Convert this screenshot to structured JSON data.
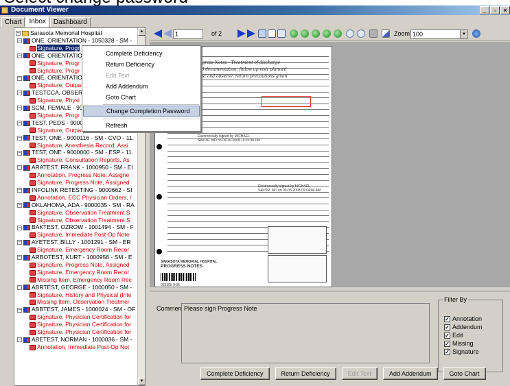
{
  "caption": "Select change password",
  "window": {
    "title": "Document Viewer",
    "minimize": "_",
    "restore": "▫",
    "close": "×"
  },
  "tabs": [
    "Chart",
    "Inbox",
    "Dashboard"
  ],
  "tree": {
    "rows": [
      {
        "type": "root",
        "label": "Sarasota Memorial Hospital"
      },
      {
        "type": "patient",
        "label": "ONE, ORIENTATION - 1050328 - SM -"
      },
      {
        "type": "item",
        "label": "Signature, Progr",
        "selected": true
      },
      {
        "type": "patient",
        "label": "ONE, ORIENTATIO"
      },
      {
        "type": "item",
        "label": "Signature, Progr"
      },
      {
        "type": "item",
        "label": "Signature, Progr"
      },
      {
        "type": "patient",
        "label": "ONE, ORIENTATIO"
      },
      {
        "type": "item",
        "label": "Signature, Outpat"
      },
      {
        "type": "patient",
        "label": "TESTCCA, OBSERV"
      },
      {
        "type": "item",
        "label": "Signature, Physi"
      },
      {
        "type": "patient",
        "label": "SCM, FEMALE - 900"
      },
      {
        "type": "item",
        "label": "Signature, Progr"
      },
      {
        "type": "patient",
        "label": "TEST, PEDS - 9000"
      },
      {
        "type": "item",
        "label": "Signature, Outpatient Physician Ord"
      },
      {
        "type": "patient",
        "label": "TEST, ONE - 9000116 - SM - CVO - 11."
      },
      {
        "type": "item",
        "label": "Signature, Anesthesia Record, Assi"
      },
      {
        "type": "patient",
        "label": "TEST, ONE - 9000000 - SM - ESP - 11."
      },
      {
        "type": "item",
        "label": "Signature, Consultation Reports, As"
      },
      {
        "type": "patient",
        "label": "ARATEST, FRANK - 1000950 - SM - EI"
      },
      {
        "type": "item",
        "label": "Annotation, Progress Note, Assigne"
      },
      {
        "type": "item",
        "label": "Signature, Progress Note, Assigned"
      },
      {
        "type": "patient",
        "label": "INFOLINK RETESTING - 9000662 - SI"
      },
      {
        "type": "item",
        "label": "Annotation, ECC Physician Orders, /"
      },
      {
        "type": "patient",
        "label": "OKLAHOMA, ADA - 9000035 - SM - RA"
      },
      {
        "type": "item",
        "label": "Signature, Observation Treatment S"
      },
      {
        "type": "item",
        "label": "Signature, Observation Treatment S"
      },
      {
        "type": "patient",
        "label": "BAKTEST, OZROW - 1001494 - SM - F"
      },
      {
        "type": "item",
        "label": "Signature, Immediate Post-Op Note"
      },
      {
        "type": "patient",
        "label": "AYETEST, BILLY - 1001291 - SM - ER"
      },
      {
        "type": "item",
        "label": "Signature, Emergency Room Recor"
      },
      {
        "type": "patient",
        "label": "ARBOTEST, KURT - 1000956 - SM - E"
      },
      {
        "type": "item",
        "label": "Signature, Progress Note, Assigned"
      },
      {
        "type": "item",
        "label": "Signature, Emergency Room Recor"
      },
      {
        "type": "item",
        "label": "Missing Item, Emergency Room Rec"
      },
      {
        "type": "patient",
        "label": "ABRTEST, GEORGE - 1000050 - SM -"
      },
      {
        "type": "item",
        "label": "Signature, History and Physical (Inte"
      },
      {
        "type": "item",
        "label": "Missing Item, Observation Treatmer"
      },
      {
        "type": "patient",
        "label": "ABBTEST, JAMES - 1000024 - SM - OF"
      },
      {
        "type": "item",
        "label": "Signature, Physician Certification for"
      },
      {
        "type": "item",
        "label": "Signature, Physician Certification for"
      },
      {
        "type": "item",
        "label": "Signature, Physician Certification for"
      },
      {
        "type": "patient",
        "label": "ABETEST, NORMAN - 1000036 - SM -"
      },
      {
        "type": "item",
        "label": "Annotation, Immediate Post-Op Not"
      }
    ]
  },
  "context_menu": {
    "items": [
      {
        "label": "Complete Deficiency",
        "disabled": false
      },
      {
        "label": "Return Deficiency",
        "disabled": false
      },
      {
        "label": "Edit Text",
        "disabled": true
      },
      {
        "label": "Add Addendum",
        "disabled": false
      },
      {
        "label": "Goto Chart",
        "disabled": false
      },
      {
        "label": "Change Completion Password",
        "disabled": false,
        "hover": true
      },
      {
        "label": "Refresh",
        "disabled": false
      }
    ]
  },
  "toolbar": {
    "page_current": "1",
    "page_of": "of 2",
    "zoom_label": "Zoom",
    "zoom_value": "100"
  },
  "document": {
    "signed_1": "Electronically signed by MICHAEL",
    "signed_1b": "SAVOR, MD on 09-26-2008 11:02:38 PM",
    "signed_2": "Electronically signed by MICHAEL",
    "signed_2b": "SAVOR, MD on 09-08-2008 09:04:04 AM",
    "hospital": "SARASOTA MEMORIAL HOSPITAL",
    "form_title": "PROGRESS NOTES",
    "form_code": "023305  9-06"
  },
  "comment": {
    "label": "Comment",
    "text": "Please sign Progress Note"
  },
  "filter": {
    "title": "Filter By",
    "options": [
      "Annotation",
      "Addendum",
      "Edit",
      "Missing",
      "Signature"
    ],
    "check": "✓"
  },
  "buttons": {
    "complete": "Complete Deficiency",
    "return": "Return Deficiency",
    "edit": "Edit Text",
    "addendum": "Add Addendum",
    "goto": "Goto Chart"
  }
}
